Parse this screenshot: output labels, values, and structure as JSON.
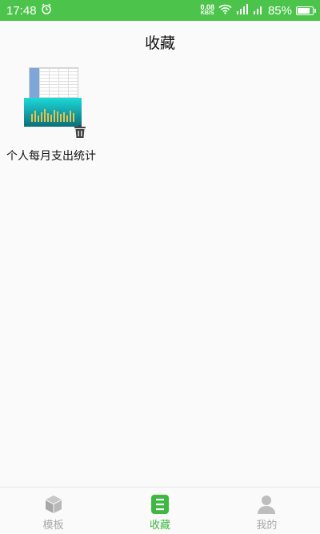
{
  "status": {
    "time": "17:48",
    "net_speed_value": "0.08",
    "net_speed_unit": "KB/S",
    "battery": "85%"
  },
  "header": {
    "title": "收藏"
  },
  "favorites": [
    {
      "title": "个人每月支出统计"
    }
  ],
  "nav": {
    "items": [
      {
        "label": "模板",
        "icon": "cube-icon",
        "active": false
      },
      {
        "label": "收藏",
        "icon": "list-icon",
        "active": true
      },
      {
        "label": "我的",
        "icon": "person-icon",
        "active": false
      }
    ]
  },
  "colors": {
    "brand": "#4cc44c",
    "active": "#3fb843",
    "inactive": "#a8a8a8"
  }
}
